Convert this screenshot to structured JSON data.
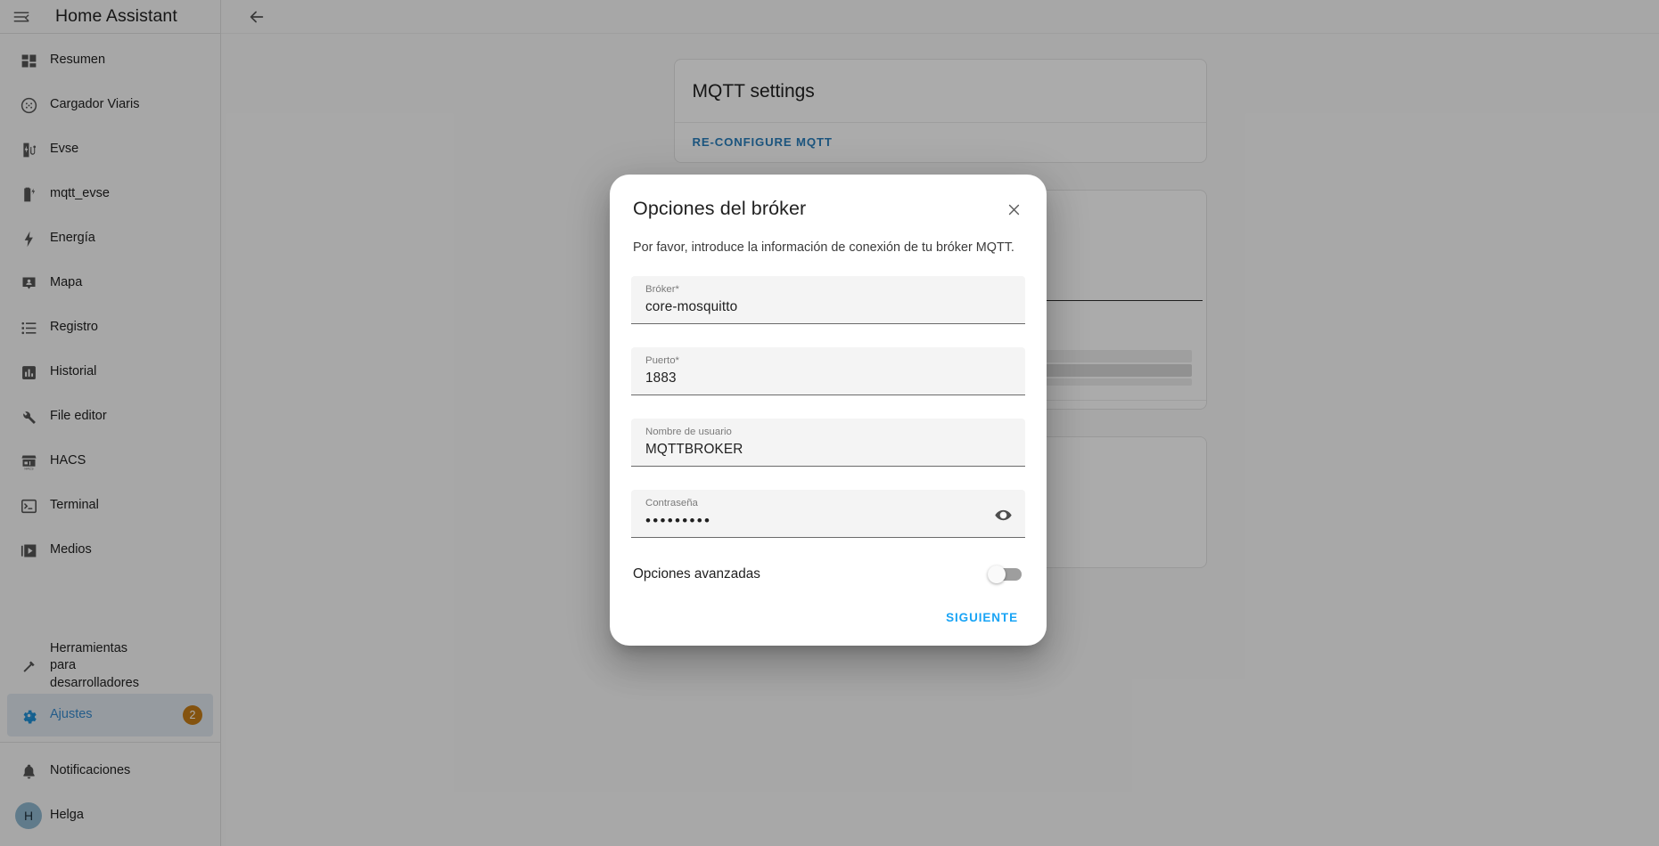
{
  "sidebar": {
    "title": "Home Assistant",
    "menu_icon": "hamburger-collapse-icon",
    "items": [
      {
        "label": "Resumen",
        "icon": "view-dashboard-icon"
      },
      {
        "label": "Cargador Viaris",
        "icon": "ev-plug-icon"
      },
      {
        "label": "Evse",
        "icon": "ev-station-icon"
      },
      {
        "label": "mqtt_evse",
        "icon": "battery-charging-icon"
      },
      {
        "label": "Energía",
        "icon": "lightning-bolt-icon"
      },
      {
        "label": "Mapa",
        "icon": "map-marker-account-icon"
      },
      {
        "label": "Registro",
        "icon": "format-list-bulleted-icon"
      },
      {
        "label": "Historial",
        "icon": "chart-box-icon"
      },
      {
        "label": "File editor",
        "icon": "wrench-icon"
      },
      {
        "label": "HACS",
        "icon": "storefront-icon"
      },
      {
        "label": "Terminal",
        "icon": "console-icon"
      },
      {
        "label": "Medios",
        "icon": "play-box-multiple-icon"
      }
    ],
    "dev_tools": {
      "label": "Herramientas para desarrolladores",
      "icon": "hammer-icon"
    },
    "settings": {
      "label": "Ajustes",
      "icon": "cog-icon",
      "badge": "2"
    },
    "notifications": {
      "label": "Notificaciones",
      "icon": "bell-icon"
    },
    "user": {
      "label": "Helga",
      "initial": "H"
    },
    "badge_color": "#c57c17",
    "selected_text_color": "#3789cd",
    "selected_bg_color": "#e0e8ef"
  },
  "topbar": {
    "back_icon": "arrow-left-icon"
  },
  "background": {
    "mqtt_card": {
      "title": "MQTT settings",
      "action_label": "RE-CONFIGURE MQTT",
      "action_color": "#2a7fbd"
    }
  },
  "dialog": {
    "title": "Opciones del bróker",
    "close_icon": "close-icon",
    "description": "Por favor, introduce la información de conexión de tu bróker MQTT.",
    "fields": [
      {
        "label": "Bróker*",
        "value": "core-mosquitto",
        "type": "text",
        "name": "broker-field"
      },
      {
        "label": "Puerto*",
        "value": "1883",
        "type": "text",
        "name": "port-field"
      },
      {
        "label": "Nombre de usuario",
        "value": "MQTTBROKER",
        "type": "text",
        "name": "username-field"
      },
      {
        "label": "Contraseña",
        "value": "•••••••••",
        "type": "password",
        "name": "password-field",
        "reveal_icon": "eye-icon"
      }
    ],
    "advanced": {
      "label": "Opciones avanzadas",
      "state": "off"
    },
    "next_label": "SIGUIENTE",
    "next_color": "#19a4f5"
  }
}
